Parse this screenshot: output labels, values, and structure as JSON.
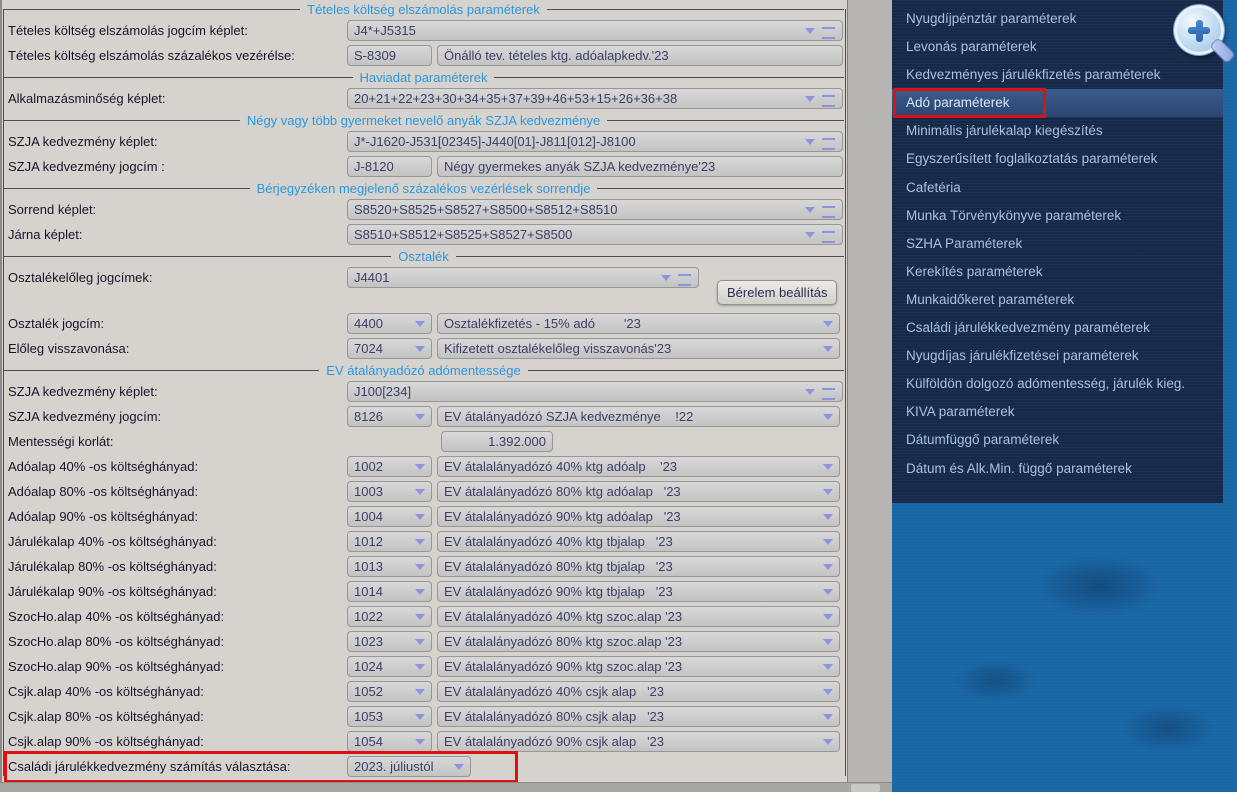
{
  "colors": {
    "form_bg": "#d6d3ce",
    "field_bg": "#c9c9c9",
    "section_title": "#2e97dc",
    "dropdown_glyph": "#8f93de",
    "highlight_red": "#dd1111",
    "sidebar_bg": "#16294a",
    "sidebar_selected_bg": "#33517f",
    "sidebar_text": "#a6c1e2",
    "right_background": "#1966a5"
  },
  "icons": {
    "dropdown_arrow": "chevron-down triangle",
    "menu_handle": "double horizontal bars",
    "magnifier": "zoom-plus magnifying glass"
  },
  "form": {
    "sections": [
      {
        "title": "Tételes költség elszámolás paraméterek",
        "rows": [
          {
            "label": "Tételes költség elszámolás jogcím képlet:",
            "fields": [
              {
                "kind": "formula",
                "value": "J4*+J5315"
              }
            ]
          },
          {
            "label": "Tételes költség elszámolás százalékos vezérélse:",
            "fields": [
              {
                "kind": "code_plain",
                "value": "S-8309"
              },
              {
                "kind": "desc_plain",
                "value": "Önálló tev. tételes ktg. adóalapkedv.'23"
              }
            ]
          }
        ]
      },
      {
        "title": "Haviadat paraméterek",
        "rows": [
          {
            "label": "Alkalmazásminőség képlet:",
            "fields": [
              {
                "kind": "formula",
                "value": "20+21+22+23+30+34+35+37+39+46+53+15+26+36+38"
              }
            ]
          }
        ]
      },
      {
        "title": "Négy vagy több gyermeket nevelő anyák SZJA kedvezménye",
        "rows": [
          {
            "label": "SZJA kedvezmény képlet:",
            "fields": [
              {
                "kind": "formula",
                "value": "J*-J1620-J531[02345]-J440[01]-J811[012]-J8100"
              }
            ]
          },
          {
            "label": "SZJA kedvezmény jogcím :",
            "fields": [
              {
                "kind": "code_plain",
                "value": "J-8120"
              },
              {
                "kind": "desc_plain",
                "value": "Négy gyermekes anyák SZJA kedvezménye'23"
              }
            ]
          }
        ]
      },
      {
        "title": "Bérjegyzéken megjelenő százalékos vezérlések sorrendje",
        "rows": [
          {
            "label": "Sorrend képlet:",
            "fields": [
              {
                "kind": "formula",
                "value": "S8520+S8525+S8527+S8500+S8512+S8510"
              }
            ]
          },
          {
            "label": "Járna képlet:",
            "fields": [
              {
                "kind": "formula",
                "value": "S8510+S8512+S8525+S8527+S8500"
              }
            ]
          }
        ]
      },
      {
        "title": "Osztalék",
        "rows": [
          {
            "label": "Osztalékelőleg jogcímek:",
            "gap_after": 24,
            "fields": [
              {
                "kind": "formula_short",
                "value": "J4401"
              },
              {
                "kind": "button",
                "value": "Bérelem beállítás"
              }
            ]
          },
          {
            "label": "Osztalék jogcím:",
            "fields": [
              {
                "kind": "code",
                "value": "4400"
              },
              {
                "kind": "desc",
                "value": "Osztalékfizetés - 15% adó        '23"
              }
            ]
          },
          {
            "label": "Előleg visszavonása:",
            "fields": [
              {
                "kind": "code",
                "value": "7024"
              },
              {
                "kind": "desc",
                "value": "Kifizetett osztalékelőleg visszavonás'23"
              }
            ]
          }
        ]
      },
      {
        "title": "EV átalányadózó adómentessége",
        "rows": [
          {
            "label": "SZJA kedvezmény képlet:",
            "fields": [
              {
                "kind": "formula",
                "value": "J100[234]"
              }
            ]
          },
          {
            "label": "SZJA kedvezmény jogcím:",
            "fields": [
              {
                "kind": "code",
                "value": "8126"
              },
              {
                "kind": "desc",
                "value": "EV átalányadózó SZJA kedvezménye    !22"
              }
            ]
          },
          {
            "label": "Mentességi korlát:",
            "fields": [
              {
                "kind": "number",
                "value": "1.392.000"
              }
            ]
          },
          {
            "label": "Adóalap 40% -os költséghányad:",
            "fields": [
              {
                "kind": "code",
                "value": "1002"
              },
              {
                "kind": "desc",
                "value": "EV átalalányadózó 40% ktg adóalp    '23"
              }
            ]
          },
          {
            "label": "Adóalap 80% -os költséghányad:",
            "fields": [
              {
                "kind": "code",
                "value": "1003"
              },
              {
                "kind": "desc",
                "value": "EV átalalányadózó 80% ktg adóalap   '23"
              }
            ]
          },
          {
            "label": "Adóalap 90% -os költséghányad:",
            "fields": [
              {
                "kind": "code",
                "value": "1004"
              },
              {
                "kind": "desc",
                "value": "EV átalalányadózó 90% ktg adóalap   '23"
              }
            ]
          },
          {
            "label": "Járulékalap 40% -os költséghányad:",
            "fields": [
              {
                "kind": "code",
                "value": "1012"
              },
              {
                "kind": "desc",
                "value": "EV átalalányadózó 40% ktg tbjalap   '23"
              }
            ]
          },
          {
            "label": "Járulékalap 80% -os költséghányad:",
            "fields": [
              {
                "kind": "code",
                "value": "1013"
              },
              {
                "kind": "desc",
                "value": "EV átalalányadózó 80% ktg tbjalap   '23"
              }
            ]
          },
          {
            "label": "Járulékalap 90% -os költséghányad:",
            "fields": [
              {
                "kind": "code",
                "value": "1014"
              },
              {
                "kind": "desc",
                "value": "EV átalalányadózó 90% ktg tbjalap   '23"
              }
            ]
          },
          {
            "label": "SzocHo.alap 40% -os költséghányad:",
            "fields": [
              {
                "kind": "code",
                "value": "1022"
              },
              {
                "kind": "desc",
                "value": "EV átalalányadózó 40% ktg szoc.alap '23"
              }
            ]
          },
          {
            "label": "SzocHo.alap 80% -os költséghányad:",
            "fields": [
              {
                "kind": "code",
                "value": "1023"
              },
              {
                "kind": "desc",
                "value": "EV átalalányadózó 80% ktg szoc.alap '23"
              }
            ]
          },
          {
            "label": "SzocHo.alap 90% -os költséghányad:",
            "fields": [
              {
                "kind": "code",
                "value": "1024"
              },
              {
                "kind": "desc",
                "value": "EV átalalányadózó 90% ktg szoc.alap '23"
              }
            ]
          },
          {
            "label": "Csjk.alap 40% -os költséghányad:",
            "fields": [
              {
                "kind": "code",
                "value": "1052"
              },
              {
                "kind": "desc",
                "value": "EV átalalányadózó 40% csjk alap   '23"
              }
            ]
          },
          {
            "label": "Csjk.alap 80% -os költséghányad:",
            "fields": [
              {
                "kind": "code",
                "value": "1053"
              },
              {
                "kind": "desc",
                "value": "EV átalalányadózó 80% csjk alap   '23"
              }
            ]
          },
          {
            "label": "Csjk.alap 90% -os költséghányad:",
            "fields": [
              {
                "kind": "code",
                "value": "1054"
              },
              {
                "kind": "desc",
                "value": "EV átalalányadózó 90% csjk alap   '23"
              }
            ]
          },
          {
            "label": "Családi járulékkedvezmény számítás választása:",
            "highlight": true,
            "fields": [
              {
                "kind": "select_small",
                "value": "2023. júliustól"
              }
            ]
          }
        ]
      }
    ]
  },
  "sidebar": {
    "items": [
      {
        "label": "Nyugdíjpénztár paraméterek"
      },
      {
        "label": "Levonás paraméterek"
      },
      {
        "label": "Kedvezményes járulékfizetés paraméterek"
      },
      {
        "label": "Adó paraméterek",
        "selected": true,
        "red_box": true
      },
      {
        "label": "Minimális járulékalap kiegészítés"
      },
      {
        "label": "Egyszerűsített foglalkoztatás paraméterek"
      },
      {
        "label": "Cafetéria"
      },
      {
        "label": "Munka Törvénykönyve paraméterek"
      },
      {
        "label": "SZHA Paraméterek"
      },
      {
        "label": "Kerekítés paraméterek"
      },
      {
        "label": "Munkaidőkeret paraméterek"
      },
      {
        "label": "Családi járulékkedvezmény paraméterek"
      },
      {
        "label": "Nyugdíjas járulékfizetései paraméterek"
      },
      {
        "label": "Külföldön dolgozó adómentesség, járulék kieg."
      },
      {
        "label": "KIVA paraméterek"
      },
      {
        "label": "Dátumfüggő paraméterek"
      },
      {
        "label": "Dátum és Alk.Min. függő paraméterek"
      }
    ]
  }
}
